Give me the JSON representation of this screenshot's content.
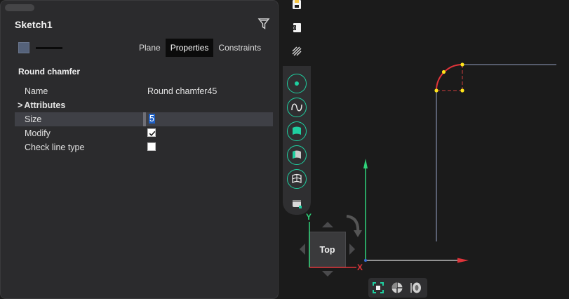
{
  "panel": {
    "title": "Sketch1",
    "tabs": [
      {
        "label": "Plane",
        "active": false
      },
      {
        "label": "Properties",
        "active": true
      },
      {
        "label": "Constraints",
        "active": false
      }
    ],
    "section_title": "Round chamfer",
    "props": {
      "name_key": "Name",
      "name_value": "Round chamfer45",
      "attributes_key": "Attributes",
      "attributes_chevron": ">",
      "size_key": "Size",
      "size_value": "5",
      "modify_key": "Modify",
      "modify_checked": true,
      "check_line_key": "Check line type",
      "check_line_checked": false
    },
    "colors": {
      "swatch": "#55627a",
      "accent": "#1fcfa0",
      "selection": "#1e5fc4"
    }
  },
  "viewcube": {
    "face_label": "Top",
    "y_axis_label": "Y",
    "x_axis_label": "X"
  },
  "icons": {
    "top_toolbar": [
      "sketch-save-icon",
      "sketch-exit-icon",
      "hatch-icon"
    ],
    "vertical_toolbar": [
      "point-icon",
      "spline-icon",
      "surface-icon",
      "surface-patch-icon",
      "mesh-surface-icon",
      "shaded-view-icon"
    ],
    "bottom_toolbar": [
      "fit-view-icon",
      "sphere-view-icon",
      "section-view-icon"
    ]
  }
}
